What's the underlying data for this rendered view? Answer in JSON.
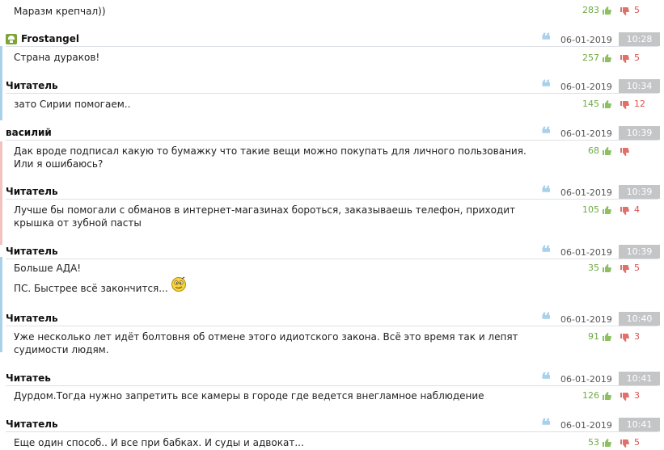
{
  "colors": {
    "positive": "#6fa945",
    "negative": "#d9534f",
    "accent_blue": "#a9d1ea",
    "accent_red": "#f3c2c0",
    "time_bg": "#c3c5c7"
  },
  "comments": [
    {
      "author": "",
      "date": "",
      "time": "",
      "lines": [
        "Маразм крепчал))"
      ],
      "pos": "283",
      "neg": "5"
    },
    {
      "author": "Frostangel",
      "date": "06-01-2019",
      "time": "10:28",
      "lines": [
        "Страна дураков!"
      ],
      "pos": "257",
      "neg": "5",
      "icon": "user-icon"
    },
    {
      "author": "Читатель",
      "date": "06-01-2019",
      "time": "10:34",
      "lines": [
        "зато Сирии помогаем.."
      ],
      "pos": "145",
      "neg": "12"
    },
    {
      "author": "василий",
      "date": "06-01-2019",
      "time": "10:39",
      "lines": [
        "Дак вроде подписал какую то бумажку что такие вещи можно покупать для личного пользования.",
        "Или я ошибаюсь?"
      ],
      "pos": "68",
      "neg": ""
    },
    {
      "author": "Читатель",
      "date": "06-01-2019",
      "time": "10:39",
      "lines": [
        "Лучше бы помогали с обманов в интернет-магазинах бороться, заказываешь телефон, приходит",
        "крышка от зубной пасты"
      ],
      "pos": "105",
      "neg": "4"
    },
    {
      "author": "Читатель",
      "date": "06-01-2019",
      "time": "10:39",
      "lines": [
        "Больше АДА!",
        "ПС. Быстрее всё закончится..."
      ],
      "pos": "35",
      "neg": "5",
      "icon": "smiley-icon"
    },
    {
      "author": "Читатель",
      "date": "06-01-2019",
      "time": "10:40",
      "lines": [
        "Уже несколько лет идёт болтовня об отмене этого идиотского закона. Всё это время так и лепят",
        "судимости людям."
      ],
      "pos": "91",
      "neg": "3"
    },
    {
      "author": "Читатеь",
      "date": "06-01-2019",
      "time": "10:41",
      "lines": [
        "Дурдом.Тогда нужно запретить все камеры в городе где ведется внегламное наблюдение"
      ],
      "pos": "126",
      "neg": "3"
    },
    {
      "author": "Читатель",
      "date": "06-01-2019",
      "time": "10:41",
      "lines": [
        "Еще один способ.. И все при бабках. И суды и адвокат..."
      ],
      "pos": "53",
      "neg": "5"
    }
  ]
}
